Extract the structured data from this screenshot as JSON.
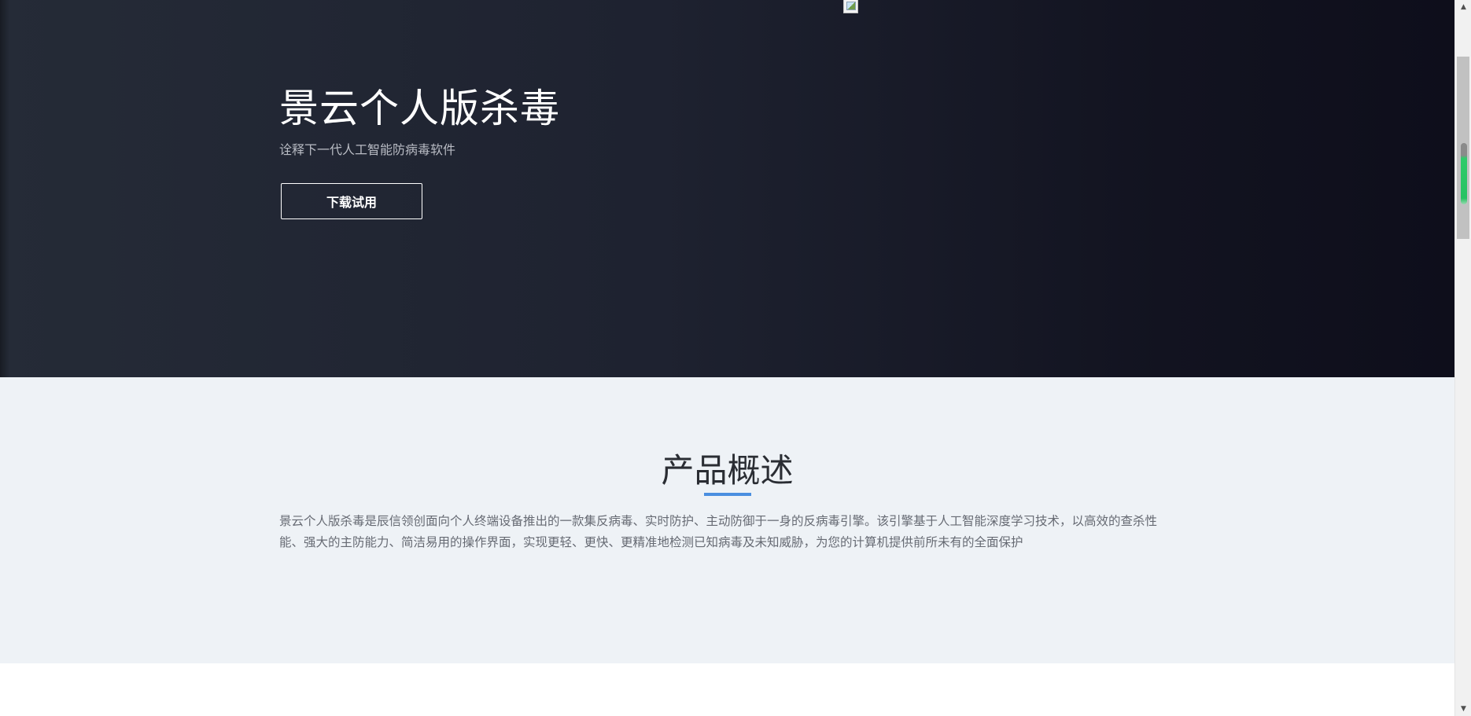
{
  "hero": {
    "title": "景云个人版杀毒",
    "subtitle": "诠释下一代人工智能防病毒软件",
    "download_button": "下载试用"
  },
  "overview": {
    "title": "产品概述",
    "description": "景云个人版杀毒是辰信领创面向个人终端设备推出的一款集反病毒、实时防护、主动防御于一身的反病毒引擎。该引擎基于人工智能深度学习技术，以高效的查杀性能、强大的主防能力、简洁易用的操作界面，实现更轻、更快、更精准地检测已知病毒及未知威胁，为您的计算机提供前所未有的全面保护"
  },
  "scrollbar": {
    "up_arrow": "▲",
    "down_arrow": "▼"
  },
  "colors": {
    "hero_gradient_start": "#252b37",
    "hero_gradient_end": "#0e0e1b",
    "overview_bg": "#eef2f6",
    "accent_underline": "#4a8fe0",
    "scroll_marker": "#27c262"
  },
  "icons": {
    "hero_image": "broken-image-icon"
  }
}
